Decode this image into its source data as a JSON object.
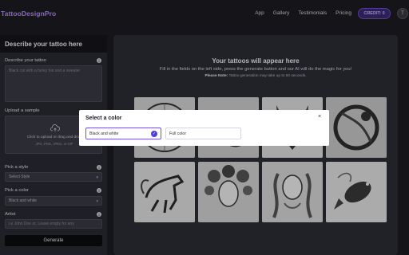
{
  "app": {
    "logo_text": "TattooDesignPro"
  },
  "nav": {
    "links": [
      "App",
      "Gallery",
      "Testimonials",
      "Pricing"
    ],
    "credit_label": "CREDIT: 0",
    "avatar_letter": "T"
  },
  "form": {
    "title": "Describe your tattoo here",
    "describe_label": "Describe your tattoo",
    "describe_placeholder": "Black cat with a funky hat and a sweater",
    "upload_label": "Upload a sample",
    "upload_text": "Click to upload or drag and drop",
    "upload_formats": "JPG, PNG, JPEG, or GIF",
    "style_label": "Pick a style",
    "style_value": "Select Style",
    "color_label": "Pick a color",
    "color_value": "Black and white",
    "artist_label": "Artist",
    "artist_placeholder": "i.e John Doe or, Leave empty for any",
    "generate_label": "Generate"
  },
  "results": {
    "title": "Your tattoos will appear here",
    "subtitle": "Fill in the fields on the left side, press the generate button and our AI will do the magic for you!",
    "note_bold": "Please Note:",
    "note_text": "Tattoo generation may take up to 60 seconds.",
    "images": [
      "ornate-mandala-tattoo",
      "dragon-swirl-tattoo",
      "wolf-head-tattoo",
      "dragon-coil-tattoo",
      "horse-running-tattoo",
      "floral-woman-tattoo",
      "wavy-hair-woman-tattoo",
      "koi-fish-tattoo"
    ]
  },
  "modal": {
    "title": "Select a color",
    "close_glyph": "×",
    "options": [
      {
        "label": "Black and white",
        "selected": true
      },
      {
        "label": "Full color",
        "selected": false
      }
    ],
    "check_glyph": "✓"
  },
  "colors": {
    "accent": "#6d55e0",
    "logo": "#b58cf5",
    "panel": "#2a2a33",
    "page": "#1b1b22"
  }
}
